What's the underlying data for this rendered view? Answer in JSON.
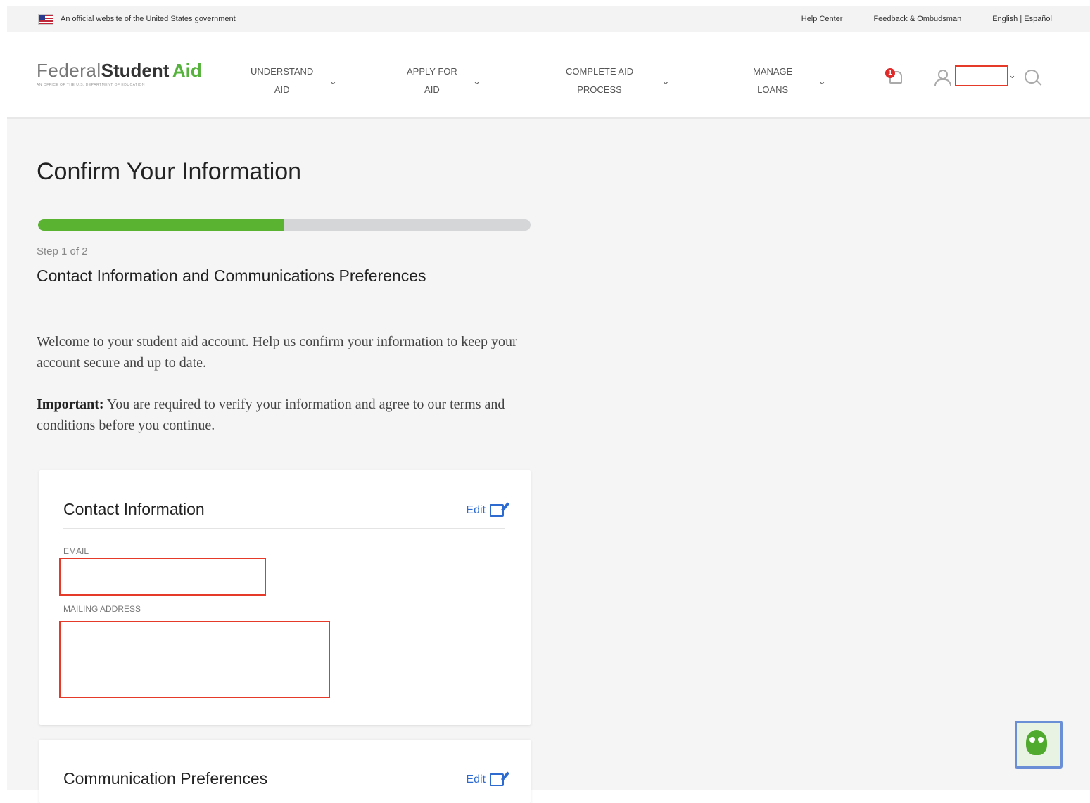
{
  "gov_banner": {
    "text": "An official website of the United States government",
    "links": [
      "Help Center",
      "Feedback & Ombudsman",
      "English | Español"
    ]
  },
  "header": {
    "logo": {
      "federal": "Federal",
      "student": "Student",
      "aid": "Aid",
      "tagline": "AN OFFICE OF THE U.S. DEPARTMENT OF EDUCATION"
    },
    "nav": [
      {
        "line1": "UNDERSTAND",
        "line2": "AID"
      },
      {
        "line1": "APPLY FOR",
        "line2": "AID"
      },
      {
        "line1": "COMPLETE AID",
        "line2": "PROCESS"
      },
      {
        "line1": "MANAGE",
        "line2": "LOANS"
      }
    ],
    "notification_count": "1"
  },
  "main": {
    "title": "Confirm Your Information",
    "progress_fraction": 0.5,
    "step_label": "Step 1 of 2",
    "step_title": "Contact Information and Communications Preferences",
    "intro": "Welcome to your student aid account. Help us confirm your information to keep your account secure and up to date.",
    "important_label": "Important:",
    "important_text": "You are required to verify your information and agree to our terms and conditions before you continue."
  },
  "contact_card": {
    "title": "Contact Information",
    "edit": "Edit",
    "email_label": "EMAIL",
    "address_label": "MAILING ADDRESS"
  },
  "comm_card": {
    "title": "Communication Preferences",
    "edit": "Edit"
  },
  "colors": {
    "progress_fill": "#5ab431",
    "link": "#2e6bd0",
    "redaction": "#e53a2a"
  }
}
